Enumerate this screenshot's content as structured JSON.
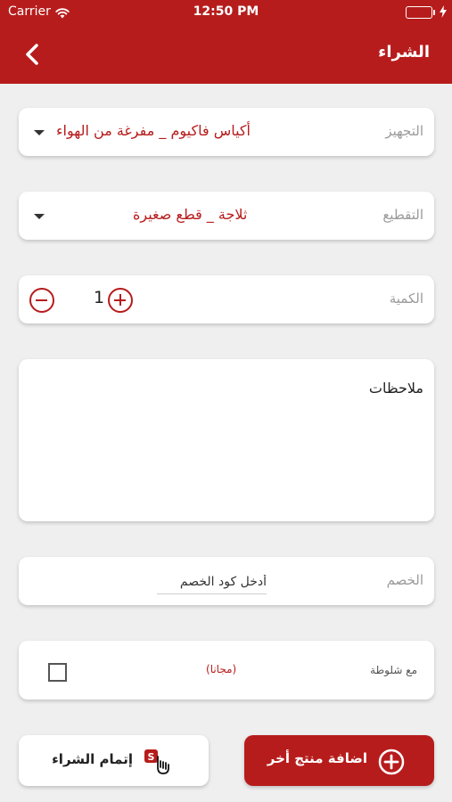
{
  "status_bar": {
    "carrier": "Carrier",
    "time": "12:50 PM",
    "battery_level": 1.0,
    "battery_color": "#4cd964"
  },
  "nav": {
    "title": "الشراء",
    "back_icon": "chevron-left-icon"
  },
  "form": {
    "packaging": {
      "label": "التجهيز",
      "value": "أكياس فاكيوم _ مفرغة من الهواء"
    },
    "cutting": {
      "label": "التقطيع",
      "value": "ثلاجة _ قطع صغيرة"
    },
    "quantity": {
      "label": "الكمية",
      "value": "1"
    },
    "notes": {
      "label": "ملاحظات",
      "value": ""
    },
    "discount": {
      "label": "الخصم",
      "placeholder": "أدخل كود الخصم",
      "value": ""
    },
    "wrap": {
      "label": "مع شلوطة",
      "free_text": "(مجانا)",
      "checked": false
    }
  },
  "actions": {
    "checkout_label": "إتمام الشراء",
    "add_product_label": "اضافة منتج أخر"
  },
  "colors": {
    "brand": "#b71c1c",
    "background": "#efefef",
    "card": "#ffffff"
  }
}
